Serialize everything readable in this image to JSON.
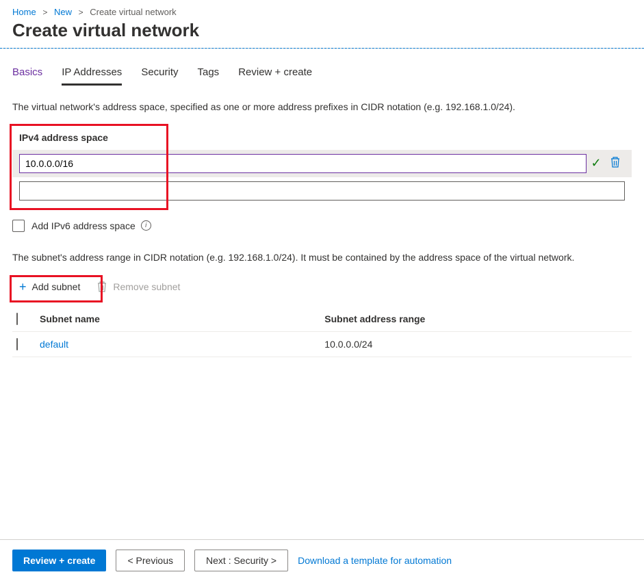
{
  "breadcrumb": {
    "home": "Home",
    "new": "New",
    "current": "Create virtual network"
  },
  "page_title": "Create virtual network",
  "tabs": {
    "basics": "Basics",
    "ip": "IP Addresses",
    "security": "Security",
    "tags": "Tags",
    "review": "Review + create"
  },
  "ipv4": {
    "description": "The virtual network's address space, specified as one or more address prefixes in CIDR notation (e.g. 192.168.1.0/24).",
    "heading": "IPv4 address space",
    "value": "10.0.0.0/16"
  },
  "ipv6": {
    "checkbox_label": "Add IPv6 address space"
  },
  "subnet": {
    "description": "The subnet's address range in CIDR notation (e.g. 192.168.1.0/24). It must be contained by the address space of the virtual network.",
    "add_label": "Add subnet",
    "remove_label": "Remove subnet",
    "col_name": "Subnet name",
    "col_range": "Subnet address range",
    "rows": [
      {
        "name": "default",
        "range": "10.0.0.0/24"
      }
    ]
  },
  "footer": {
    "review": "Review + create",
    "previous": "<  Previous",
    "next": "Next : Security  >",
    "download": "Download a template for automation"
  }
}
